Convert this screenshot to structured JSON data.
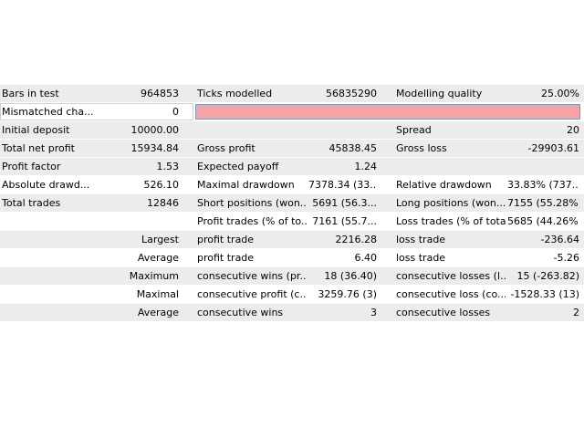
{
  "rows": [
    {
      "c1": "Bars in test",
      "v1": "964853",
      "c2": "Ticks modelled",
      "v2": "56835290",
      "c3": "Modelling quality",
      "v3": "25.00%"
    },
    {
      "c1": "Mismatched cha...",
      "v1": "0"
    },
    {
      "c1": "Initial deposit",
      "v1": "10000.00",
      "c2": "",
      "v2": "",
      "c3": "Spread",
      "v3": "20"
    },
    {
      "c1": "Total net profit",
      "v1": "15934.84",
      "c2": "Gross profit",
      "v2": "45838.45",
      "c3": "Gross loss",
      "v3": "-29903.61"
    },
    {
      "c1": "Profit factor",
      "v1": "1.53",
      "c2": "Expected payoff",
      "v2": "1.24",
      "c3": "",
      "v3": ""
    },
    {
      "c1": "Absolute drawd...",
      "v1": "526.10",
      "c2": "Maximal drawdown",
      "v2": "7378.34 (33...",
      "c3": "Relative drawdown",
      "v3": "33.83% (737..."
    },
    {
      "c1": "Total trades",
      "v1": "12846",
      "c2": "Short positions (won...",
      "v2": "5691 (56.3...",
      "c3": "Long positions (won...",
      "v3": "7155 (55.28%)"
    },
    {
      "c1": "",
      "v1": "",
      "c2": "Profit trades (% of to...",
      "v2": "7161 (55.7...",
      "c3": "Loss trades (% of total)",
      "v3": "5685 (44.26%)"
    },
    {
      "c1r": "Largest",
      "c2": "profit trade",
      "v2": "2216.28",
      "c3": "loss trade",
      "v3": "-236.64"
    },
    {
      "c1r": "Average",
      "c2": "profit trade",
      "v2": "6.40",
      "c3": "loss trade",
      "v3": "-5.26"
    },
    {
      "c1r": "Maximum",
      "c2": "consecutive wins (pr...",
      "v2": "18 (36.40)",
      "c3": "consecutive losses (l...",
      "v3": "15 (-263.82)"
    },
    {
      "c1r": "Maximal",
      "c2": "consecutive profit (c...",
      "v2": "3259.76 (3)",
      "c3": "consecutive loss (co...",
      "v3": "-1528.33 (13)"
    },
    {
      "c1r": "Average",
      "c2": "consecutive wins",
      "v2": "3",
      "c3": "consecutive losses",
      "v3": "2"
    }
  ]
}
